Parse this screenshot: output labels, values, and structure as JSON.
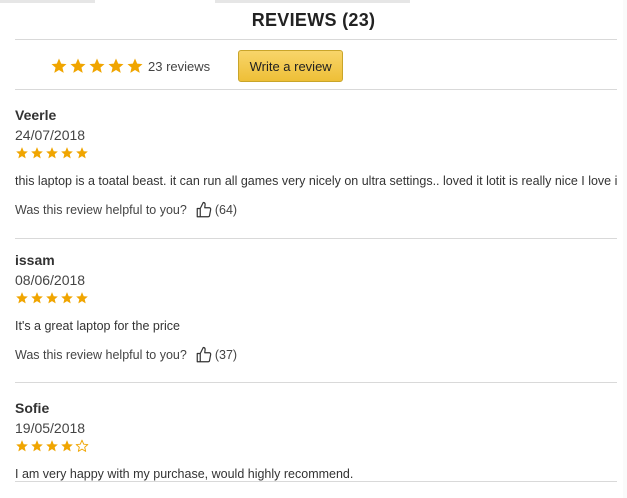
{
  "header": {
    "title": "REVIEWS (23)"
  },
  "summary": {
    "rating": 5,
    "count_label": "23 reviews",
    "write_button_label": "Write a review"
  },
  "colors": {
    "star_fill": "#f0a500",
    "star_outline": "#f0a500",
    "button": "#f2c744"
  },
  "reviews": [
    {
      "name": "Veerle",
      "date": "24/07/2018",
      "rating": 5,
      "text": "this laptop is a toatal beast. it can run all games very nicely on ultra settings.. loved it lotit is really nice I love it",
      "helpful_label": "Was this review helpful to you?",
      "helpful_count": "(64)"
    },
    {
      "name": "issam",
      "date": "08/06/2018",
      "rating": 5,
      "text": "It's a great laptop for the price",
      "helpful_label": "Was this review helpful to you?",
      "helpful_count": "(37)"
    },
    {
      "name": "Sofie",
      "date": "19/05/2018",
      "rating": 4,
      "text": "I am very happy with my purchase, would highly recommend.",
      "helpful_label": "",
      "helpful_count": ""
    }
  ]
}
